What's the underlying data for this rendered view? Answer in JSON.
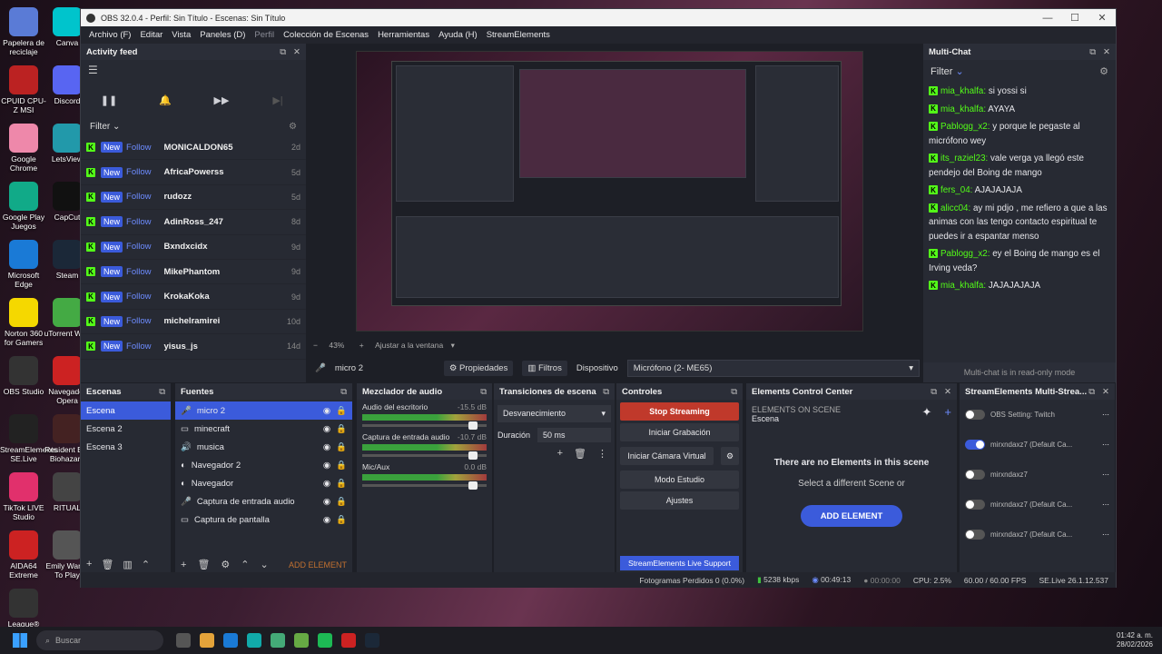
{
  "desktop_icons": [
    {
      "label": "Papelera de reciclaje",
      "color": "#5a7bd6",
      "glyph": "recycle-bin"
    },
    {
      "label": "Canva",
      "color": "#00c4cc",
      "glyph": "canva"
    },
    {
      "label": "CPUID CPU-Z MSI",
      "color": "#b22",
      "glyph": "cpuz"
    },
    {
      "label": "Discord",
      "color": "#5865f2",
      "glyph": "discord"
    },
    {
      "label": "Google Chrome",
      "color": "#e8a",
      "glyph": "chrome"
    },
    {
      "label": "LetsView",
      "color": "#29a",
      "glyph": "letsview"
    },
    {
      "label": "Google Play Juegos",
      "color": "#1a8",
      "glyph": "play"
    },
    {
      "label": "CapCut",
      "color": "#111",
      "glyph": "capcut"
    },
    {
      "label": "Microsoft Edge",
      "color": "#1a7ad6",
      "glyph": "edge"
    },
    {
      "label": "Steam",
      "color": "#1b2838",
      "glyph": "steam"
    },
    {
      "label": "Norton 360 for Gamers",
      "color": "#f5d800",
      "glyph": "norton"
    },
    {
      "label": "uTorrent Web",
      "color": "#4a4",
      "glyph": "utorrent"
    },
    {
      "label": "OBS Studio",
      "color": "#333",
      "glyph": "obs"
    },
    {
      "label": "Navegador Opera",
      "color": "#c22",
      "glyph": "opera"
    },
    {
      "label": "StreamElements SE.Live",
      "color": "#222",
      "glyph": "se"
    },
    {
      "label": "Resident Evil Biohazard",
      "color": "#422",
      "glyph": "re"
    },
    {
      "label": "TikTok LIVE Studio",
      "color": "#e1306c",
      "glyph": "tiktok"
    },
    {
      "label": "RITUAL",
      "color": "#444",
      "glyph": "ritual"
    },
    {
      "label": "AIDA64 Extreme",
      "color": "#c22",
      "glyph": "aida"
    },
    {
      "label": "Emily Wants To Play",
      "color": "#555",
      "glyph": "emily"
    },
    {
      "label": "League®",
      "color": "#333",
      "glyph": "league"
    }
  ],
  "window": {
    "title": "OBS 32.0.4 - Perfil: Sin Título - Escenas: Sin Título",
    "min": "—",
    "max": "☐",
    "close": "✕"
  },
  "menu": [
    "Archivo (F)",
    "Editar",
    "Vista",
    "Paneles (D)",
    "Perfil",
    "Colección de Escenas",
    "Herramientas",
    "Ayuda (H)",
    "StreamElements"
  ],
  "feed": {
    "title": "Activity feed",
    "filter": "Filter",
    "rows": [
      {
        "tag": "New",
        "type": "Follow",
        "name": "MONICALDON65",
        "time": "2d"
      },
      {
        "tag": "New",
        "type": "Follow",
        "name": "AfricaPowerss",
        "time": "5d"
      },
      {
        "tag": "New",
        "type": "Follow",
        "name": "rudozz",
        "time": "5d"
      },
      {
        "tag": "New",
        "type": "Follow",
        "name": "AdinRoss_247",
        "time": "8d"
      },
      {
        "tag": "New",
        "type": "Follow",
        "name": "Bxndxcidx",
        "time": "9d"
      },
      {
        "tag": "New",
        "type": "Follow",
        "name": "MikePhantom",
        "time": "9d"
      },
      {
        "tag": "New",
        "type": "Follow",
        "name": "KrokaKoka",
        "time": "9d"
      },
      {
        "tag": "New",
        "type": "Follow",
        "name": "michelramirei",
        "time": "10d"
      },
      {
        "tag": "New",
        "type": "Follow",
        "name": "yisus_js",
        "time": "14d"
      }
    ]
  },
  "preview": {
    "zoom": "43%",
    "fit": "Ajustar a la ventana"
  },
  "propbar": {
    "source": "micro 2",
    "props": "Propiedades",
    "filters": "Filtros",
    "device_label": "Dispositivo",
    "device": "Micrófono (2- ME65)"
  },
  "multichat": {
    "title": "Multi-Chat",
    "filter": "Filter",
    "readonly": "Multi-chat is in read-only mode",
    "messages": [
      {
        "user": "mia_khalfa:",
        "text": "si yossi si"
      },
      {
        "user": "mia_khalfa:",
        "text": "AYAYA"
      },
      {
        "user": "Pablogg_x2:",
        "text": "y porque le pegaste al micrófono wey"
      },
      {
        "user": "its_raziel23:",
        "text": "vale verga ya llegó este pendejo del Boing de mango"
      },
      {
        "user": "fers_04:",
        "text": "AJAJAJAJA"
      },
      {
        "user": "alicc04:",
        "text": "ay mi pdjo , me refiero a que a las animas con las tengo contacto espiritual te puedes ir a espantar menso"
      },
      {
        "user": "Pablogg_x2:",
        "text": "ey el Boing de mango es el Irving veda?"
      },
      {
        "user": "mia_khalfa:",
        "text": "JAJAJAJAJA"
      }
    ]
  },
  "scenes": {
    "title": "Escenas",
    "items": [
      "Escena",
      "Escena 2",
      "Escena 3"
    ]
  },
  "sources": {
    "title": "Fuentes",
    "items": [
      "micro 2",
      "minecraft",
      "musica",
      "Navegador 2",
      "Navegador",
      "Captura de entrada audio",
      "Captura de pantalla"
    ],
    "add": "ADD ELEMENT"
  },
  "mixer": {
    "title": "Mezclador de audio",
    "channels": [
      {
        "name": "Audio del escritorio",
        "db": "-15.5 dB"
      },
      {
        "name": "Captura de entrada audio",
        "db": "-10.7 dB"
      },
      {
        "name": "Mic/Aux",
        "db": "0.0 dB"
      }
    ]
  },
  "transitions": {
    "title": "Transiciones de escena",
    "type": "Desvanecimiento",
    "duration_label": "Duración",
    "duration": "50 ms"
  },
  "controls": {
    "title": "Controles",
    "buttons": [
      "Stop Streaming",
      "Iniciar Grabación",
      "Iniciar Cámara Virtual",
      "Modo Estudio",
      "Ajustes"
    ],
    "support": "StreamElements Live Support"
  },
  "aecc": {
    "title": "Elements Control Center",
    "subtitle": "ELEMENTS ON SCENE",
    "scene": "Escena",
    "empty": "There are no Elements in this scene",
    "hint": "Select a different Scene or",
    "add": "ADD ELEMENT"
  },
  "semulti": {
    "title": "StreamElements Multi-Strea...",
    "rows": [
      {
        "name": "OBS Setting: Twitch",
        "on": false
      },
      {
        "name": "mirxndaxz7 (Default Ca...",
        "on": true
      },
      {
        "name": "mirxndaxz7",
        "on": false
      },
      {
        "name": "mirxndaxz7 (Default Ca...",
        "on": false
      },
      {
        "name": "mirxndaxz7 (Default Ca...",
        "on": false
      }
    ]
  },
  "status": {
    "dropped": "Fotogramas Perdidos 0 (0.0%)",
    "kbps": "5238 kbps",
    "live": "00:49:13",
    "rec": "00:00:00",
    "cpu": "CPU: 2.5%",
    "fps": "60.00 / 60.00 FPS",
    "ver": "SE.Live 26.1.12.537"
  },
  "taskbar": {
    "search": "Buscar",
    "time": "01:42 a. m.",
    "date": "28/02/2026"
  }
}
